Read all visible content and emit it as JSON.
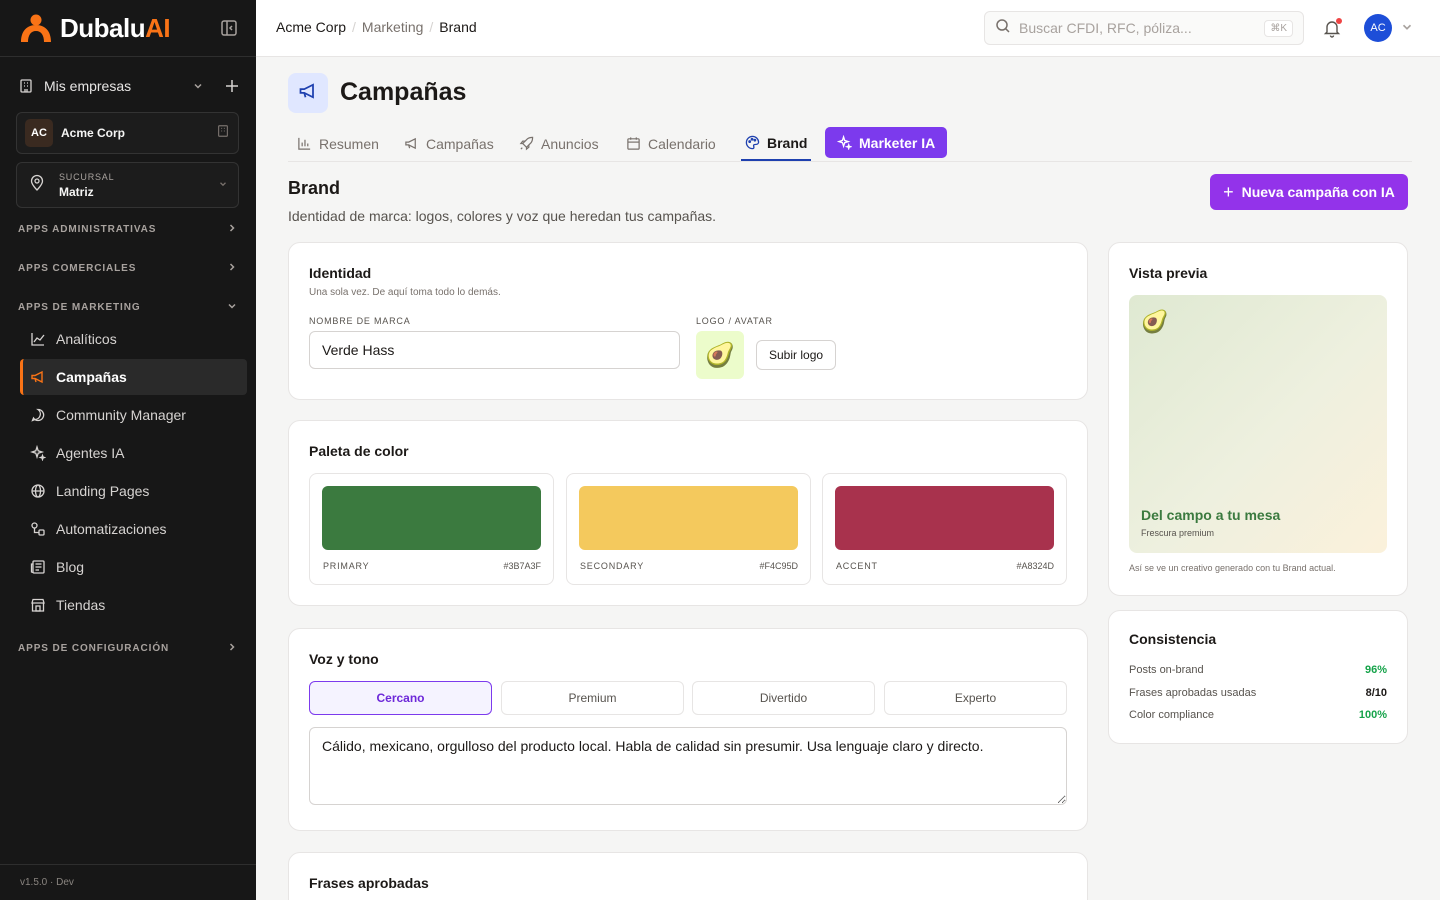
{
  "brand": {
    "name_main": "Dubalu",
    "name_ai": "AI"
  },
  "sidebar": {
    "mis_empresas": "Mis empresas",
    "company": {
      "initials": "AC",
      "name": "Acme Corp"
    },
    "branch": {
      "label": "SUCURSAL",
      "name": "Matriz"
    },
    "sections": {
      "admin": "APPS ADMINISTRATIVAS",
      "comerciales": "APPS COMERCIALES",
      "marketing": "APPS DE MARKETING",
      "config": "APPS DE CONFIGURACIÓN"
    },
    "items": [
      {
        "label": "Analíticos",
        "icon": "chart-line-icon"
      },
      {
        "label": "Campañas",
        "icon": "megaphone-icon",
        "active": true
      },
      {
        "label": "Community Manager",
        "icon": "chat-bubble-icon"
      },
      {
        "label": "Agentes IA",
        "icon": "sparkles-icon"
      },
      {
        "label": "Landing Pages",
        "icon": "globe-icon"
      },
      {
        "label": "Automatizaciones",
        "icon": "workflow-icon"
      },
      {
        "label": "Blog",
        "icon": "newspaper-icon"
      },
      {
        "label": "Tiendas",
        "icon": "store-icon"
      }
    ],
    "version": "v1.5.0 · Dev"
  },
  "topbar": {
    "breadcrumbs": [
      "Acme Corp",
      "Marketing",
      "Brand"
    ],
    "search_placeholder": "Buscar CFDI, RFC, póliza...",
    "search_shortcut": "⌘K",
    "user_initials": "AC"
  },
  "page": {
    "title": "Campañas",
    "tabs": [
      {
        "label": "Resumen",
        "icon": "bar-chart-icon"
      },
      {
        "label": "Campañas",
        "icon": "megaphone-icon"
      },
      {
        "label": "Anuncios",
        "icon": "rocket-icon"
      },
      {
        "label": "Calendario",
        "icon": "calendar-icon"
      },
      {
        "label": "Brand",
        "icon": "palette-icon",
        "active": true
      }
    ],
    "ia_tab": "Marketer IA",
    "section_title": "Brand",
    "section_desc": "Identidad de marca: logos, colores y voz que heredan tus campañas.",
    "new_button": "Nueva campaña con IA"
  },
  "identity": {
    "title": "Identidad",
    "subtitle": "Una sola vez. De aquí toma todo lo demás.",
    "brand_name_label": "NOMBRE DE MARCA",
    "brand_name_value": "Verde Hass",
    "logo_label": "LOGO / AVATAR",
    "logo_emoji": "🥑",
    "upload_label": "Subir logo"
  },
  "palette": {
    "title": "Paleta de color",
    "colors": [
      {
        "name": "PRIMARY",
        "hex": "#3B7A3F"
      },
      {
        "name": "SECONDARY",
        "hex": "#F4C95D"
      },
      {
        "name": "ACCENT",
        "hex": "#A8324D"
      }
    ]
  },
  "voice": {
    "title": "Voz y tono",
    "tones": [
      "Cercano",
      "Premium",
      "Divertido",
      "Experto"
    ],
    "active_tone": "Cercano",
    "text": "Cálido, mexicano, orgulloso del producto local. Habla de calidad sin presumir. Usa lenguaje claro y directo."
  },
  "phrases": {
    "title": "Frases aprobadas"
  },
  "preview": {
    "title": "Vista previa",
    "emoji": "🥑",
    "headline": "Del campo a tu mesa",
    "tagline": "Frescura premium",
    "caption": "Así se ve un creativo generado con tu Brand actual."
  },
  "consistency": {
    "title": "Consistencia",
    "rows": [
      {
        "label": "Posts on-brand",
        "value": "96%",
        "color": "#16a34a"
      },
      {
        "label": "Frases aprobadas usadas",
        "value": "8/10",
        "color": "#1c1917"
      },
      {
        "label": "Color compliance",
        "value": "100%",
        "color": "#16a34a"
      }
    ]
  }
}
